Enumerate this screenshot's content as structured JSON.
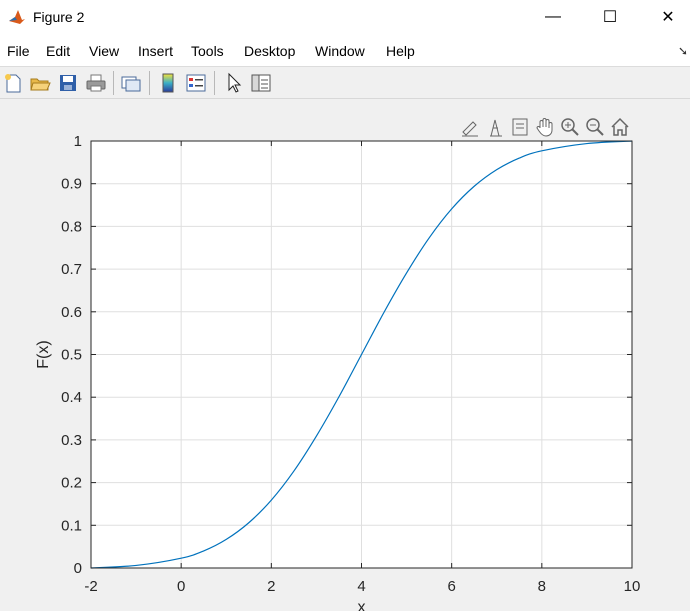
{
  "window": {
    "title": "Figure 2",
    "controls": {
      "minimize": "—",
      "maximize": "☐",
      "close": "✕"
    }
  },
  "menu": {
    "items": [
      "File",
      "Edit",
      "View",
      "Insert",
      "Tools",
      "Desktop",
      "Window",
      "Help"
    ]
  },
  "toolbar": {
    "icons": [
      "new-figure-icon",
      "open-file-icon",
      "save-icon",
      "print-icon",
      "link-plot-icon",
      "insert-colorbar-icon",
      "insert-legend-icon",
      "edit-plot-icon",
      "property-inspector-icon"
    ]
  },
  "axes_toolbar": {
    "icons": [
      "brush-icon",
      "data-tips-icon",
      "export-icon",
      "pan-icon",
      "zoom-in-icon",
      "zoom-out-icon",
      "home-icon"
    ]
  },
  "colors": {
    "line": "#0072bd",
    "grid": "#dfdfdf",
    "axes_bg": "#ffffff"
  },
  "chart_data": {
    "type": "line",
    "title": "",
    "xlabel": "x",
    "ylabel": "F(x)",
    "xlim": [
      -2,
      10
    ],
    "ylim": [
      0,
      1
    ],
    "xticks": [
      "-2",
      "0",
      "2",
      "4",
      "6",
      "8",
      "10"
    ],
    "yticks": [
      "0",
      "0.1",
      "0.2",
      "0.3",
      "0.4",
      "0.5",
      "0.6",
      "0.7",
      "0.8",
      "0.9",
      "1"
    ],
    "grid": true,
    "series": [
      {
        "x": [
          -2,
          -1,
          0,
          0.5,
          1,
          1.5,
          2,
          2.5,
          3,
          3.5,
          4,
          4.5,
          5,
          5.5,
          6,
          6.5,
          7,
          7.5,
          8,
          9,
          10
        ],
        "y": [
          0.0,
          0.006,
          0.023,
          0.04,
          0.067,
          0.106,
          0.159,
          0.227,
          0.309,
          0.401,
          0.5,
          0.599,
          0.691,
          0.773,
          0.841,
          0.894,
          0.933,
          0.96,
          0.977,
          0.994,
          1.0
        ]
      }
    ]
  }
}
